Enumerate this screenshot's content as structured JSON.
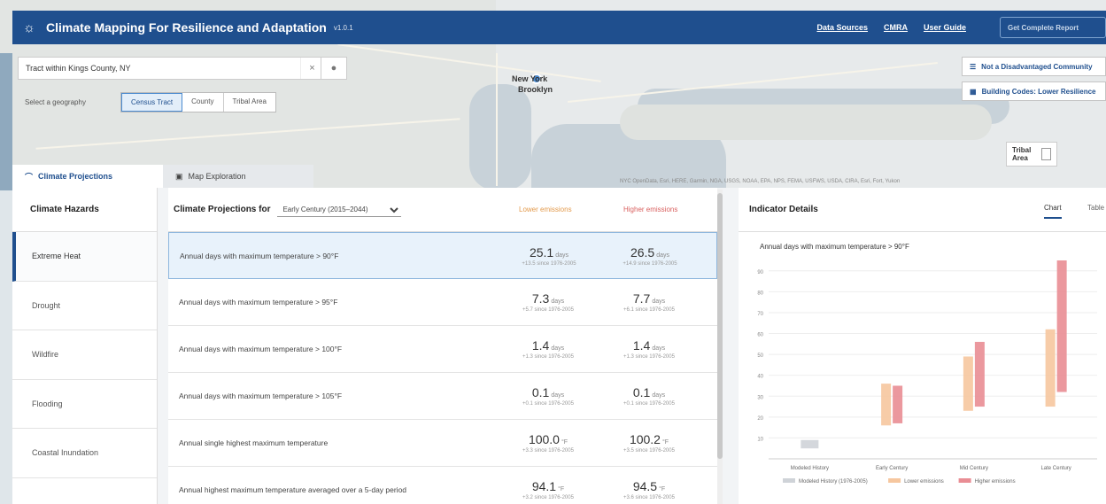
{
  "header": {
    "title": "Climate Mapping For Resilience and Adaptation",
    "version": "v1.0.1",
    "links": [
      "Data Sources",
      "CMRA",
      "User Guide"
    ],
    "login": "Get Complete Report"
  },
  "map": {
    "labels": [
      "New York",
      "Brooklyn"
    ],
    "attribution": "NYC OpenData, Esri, HERE, Garmin, NGA, USGS, NOAA, EPA, NPS, FEMA, USFWS, USDA, CIRA, Esri, Fort, Yukon"
  },
  "search": {
    "value": "Tract within Kings County, NY",
    "clear_icon": "close-icon",
    "search_icon": "search-icon",
    "locate_icon": "location-icon"
  },
  "geography": {
    "label": "Select a geography",
    "options": [
      "Census Tract",
      "County",
      "Tribal Area"
    ],
    "selected": "Census Tract"
  },
  "layers": {
    "disadvantaged": "Not a Disadvantaged Community",
    "building_codes": "Building Codes: Lower Resilience"
  },
  "tribal_toggle": {
    "label": "Tribal Area"
  },
  "tabs": [
    {
      "label": "Climate Projections",
      "icon": "thermometer-icon"
    },
    {
      "label": "Map Exploration",
      "icon": "map-icon"
    }
  ],
  "sidebar": {
    "header": "Climate Hazards",
    "items": [
      "Extreme Heat",
      "Drought",
      "Wildfire",
      "Flooding",
      "Coastal Inundation"
    ],
    "active": "Extreme Heat"
  },
  "projections": {
    "title": "Climate Projections for",
    "period": "Early Century (2015–2044)",
    "lower_label": "Lower emissions",
    "higher_label": "Higher emissions",
    "rows": [
      {
        "name": "Annual days with maximum temperature > 90°F",
        "lower": "25.1",
        "lower_unit": "days",
        "lower_range": "+13.5 since 1976-2005",
        "higher": "26.5",
        "higher_unit": "days",
        "higher_range": "+14.9 since 1976-2005"
      },
      {
        "name": "Annual days with maximum temperature > 95°F",
        "lower": "7.3",
        "lower_unit": "days",
        "lower_range": "+5.7 since 1976-2005",
        "higher": "7.7",
        "higher_unit": "days",
        "higher_range": "+6.1 since 1976-2005"
      },
      {
        "name": "Annual days with maximum temperature > 100°F",
        "lower": "1.4",
        "lower_unit": "days",
        "lower_range": "+1.3 since 1976-2005",
        "higher": "1.4",
        "higher_unit": "days",
        "higher_range": "+1.3 since 1976-2005"
      },
      {
        "name": "Annual days with maximum temperature > 105°F",
        "lower": "0.1",
        "lower_unit": "days",
        "lower_range": "+0.1 since 1976-2005",
        "higher": "0.1",
        "higher_unit": "days",
        "higher_range": "+0.1 since 1976-2005"
      },
      {
        "name": "Annual single highest maximum temperature",
        "lower": "100.0",
        "lower_unit": "°F",
        "lower_range": "+3.3 since 1976-2005",
        "higher": "100.2",
        "higher_unit": "°F",
        "higher_range": "+3.5 since 1976-2005"
      },
      {
        "name": "Annual highest maximum temperature averaged over a 5-day period",
        "lower": "94.1",
        "lower_unit": "°F",
        "lower_range": "+3.2 since 1976-2005",
        "higher": "94.5",
        "higher_unit": "°F",
        "higher_range": "+3.6 since 1976-2005"
      }
    ]
  },
  "detail": {
    "title": "Indicator Details",
    "tab_chart": "Chart",
    "tab_table": "Table",
    "chart_title": "Annual days with maximum temperature > 90°F"
  },
  "colors": {
    "header": "#1f4f8e",
    "lower": "#f6c79f",
    "higher": "#e98d94",
    "modeled": "#cfd3d8"
  },
  "chart_data": {
    "type": "bar",
    "title": "Annual days with maximum temperature > 90°F",
    "categories": [
      "Modeled History",
      "Early Century",
      "Mid Century",
      "Late Century"
    ],
    "ylim": [
      0,
      95
    ],
    "yticks": [
      10,
      20,
      30,
      40,
      50,
      60,
      70,
      80,
      90
    ],
    "series": [
      {
        "name": "Modeled History (1976-2005)",
        "ranges": [
          [
            5,
            9
          ],
          null,
          null,
          null
        ]
      },
      {
        "name": "Lower emissions",
        "ranges": [
          null,
          [
            16,
            36
          ],
          [
            23,
            49
          ],
          [
            25,
            62
          ]
        ]
      },
      {
        "name": "Higher emissions",
        "ranges": [
          null,
          [
            17,
            35
          ],
          [
            25,
            56
          ],
          [
            32,
            95
          ]
        ]
      }
    ],
    "legend": "bottom"
  }
}
